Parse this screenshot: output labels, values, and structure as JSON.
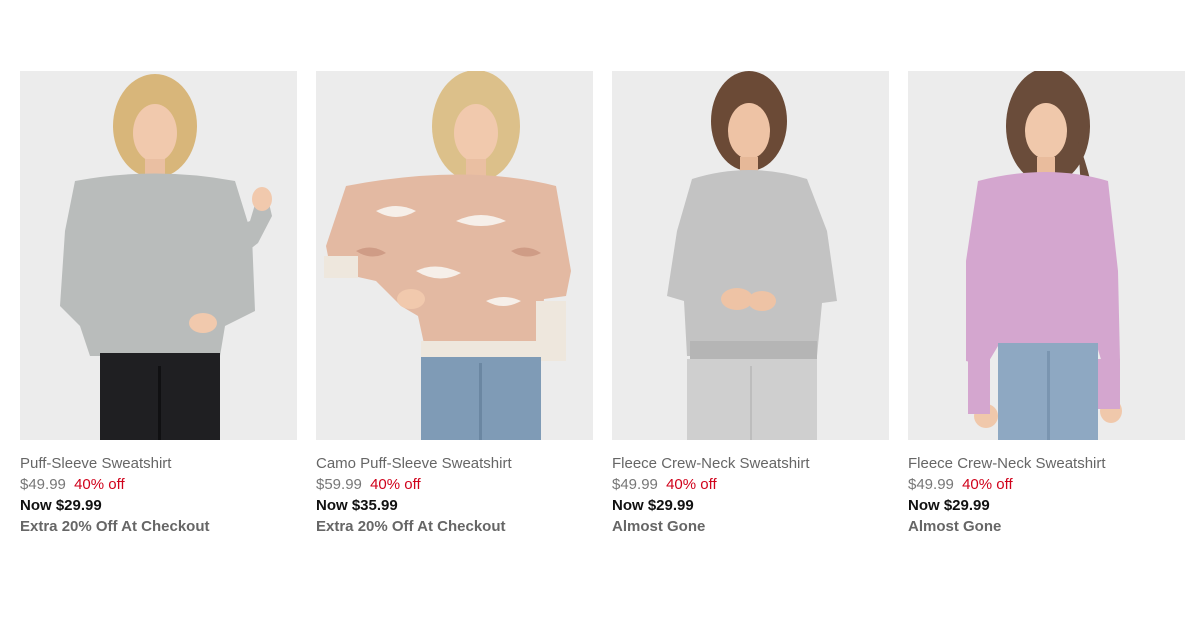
{
  "colors": {
    "accent_red": "#d0021b",
    "photo_bg": "#ececec",
    "sweater_gray": "#b9bcbb",
    "sweater_camo": "#e3b9a2",
    "sweater_fleece_gray": "#c3c3c3",
    "sweater_pink": "#d4a6cf"
  },
  "products": [
    {
      "name": "Puff-Sleeve Sweatshirt",
      "was_price": "$49.99",
      "discount": "40% off",
      "now_price": "Now $29.99",
      "promo": "Extra 20% Off At Checkout",
      "image_icon": "model-gray-puff-sleeve-photo"
    },
    {
      "name": "Camo Puff-Sleeve Sweatshirt",
      "was_price": "$59.99",
      "discount": "40% off",
      "now_price": "Now $35.99",
      "promo": "Extra 20% Off At Checkout",
      "image_icon": "model-camo-puff-sleeve-photo"
    },
    {
      "name": "Fleece Crew-Neck Sweatshirt",
      "was_price": "$49.99",
      "discount": "40% off",
      "now_price": "Now $29.99",
      "promo": "Almost Gone",
      "image_icon": "model-gray-fleece-photo"
    },
    {
      "name": "Fleece Crew-Neck Sweatshirt",
      "was_price": "$49.99",
      "discount": "40% off",
      "now_price": "Now $29.99",
      "promo": "Almost Gone",
      "image_icon": "model-pink-fleece-photo"
    }
  ]
}
